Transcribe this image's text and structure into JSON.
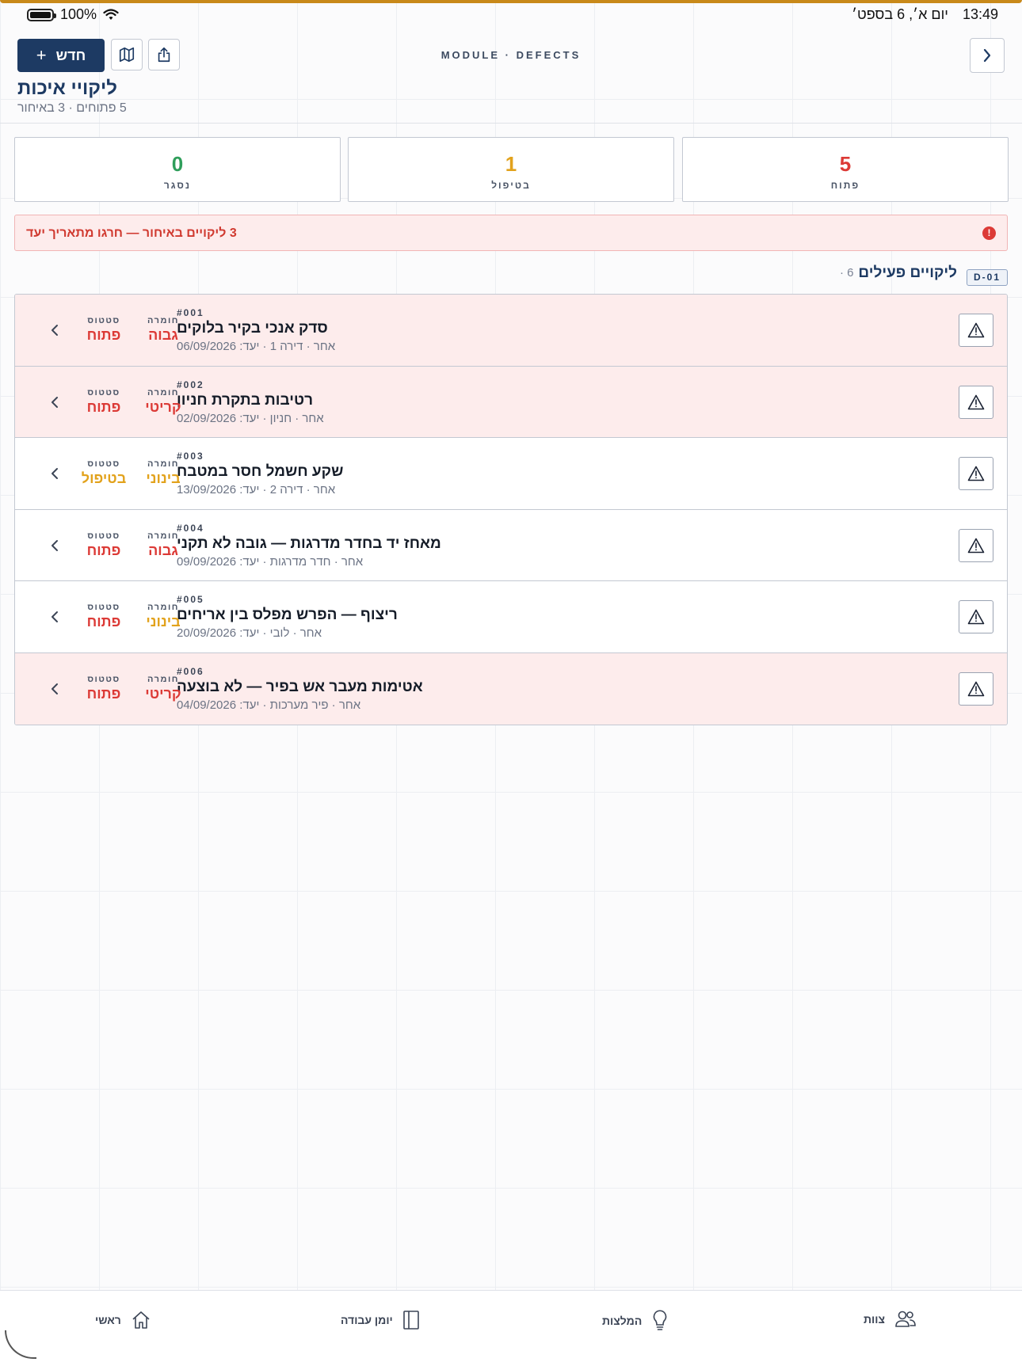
{
  "statusbar": {
    "battery": "100%",
    "time": "13:49",
    "date": "יום א׳, 6 בספט׳"
  },
  "header": {
    "new_button": "חדש",
    "module_label": "MODULE · DEFECTS",
    "title": "ליקויי איכות",
    "subtitle": "5 פתוחים · 3 באיחור",
    "icons": {
      "map": "map-icon",
      "share": "share-icon",
      "back": "chevron-right-icon",
      "plus": "plus-icon"
    }
  },
  "stats": [
    {
      "value": "5",
      "label": "פתוח",
      "color": "#dc3a36"
    },
    {
      "value": "1",
      "label": "בטיפול",
      "color": "#e2a21c"
    },
    {
      "value": "0",
      "label": "נסגר",
      "color": "#2f9e5b"
    }
  ],
  "alert": {
    "text": "3 ליקויים באיחור — חרגו מתאריך יעד",
    "icon": "alert-circle-icon"
  },
  "section": {
    "code": "D-01",
    "title": "ליקויים פעילים",
    "count": "· 6"
  },
  "columns": {
    "severity": "חומרה",
    "status": "סטטוס"
  },
  "defects": [
    {
      "code": "#001",
      "title": "סדק אנכי בקיר בלוקים",
      "meta": "אחר · דירה 1 · יעד: 06/09/2026",
      "severity": "גבוה",
      "severity_color": "#dc3a36",
      "status": "פתוח",
      "status_color": "#dc3a36",
      "overdue": true
    },
    {
      "code": "#002",
      "title": "רטיבות בתקרת חניון",
      "meta": "אחר · חניון · יעד: 02/09/2026",
      "severity": "קריטי",
      "severity_color": "#dc3a36",
      "status": "פתוח",
      "status_color": "#dc3a36",
      "overdue": true
    },
    {
      "code": "#003",
      "title": "שקע חשמל חסר במטבח",
      "meta": "אחר · דירה 2 · יעד: 13/09/2026",
      "severity": "בינוני",
      "severity_color": "#e2a21c",
      "status": "בטיפול",
      "status_color": "#e2a21c",
      "overdue": false
    },
    {
      "code": "#004",
      "title": "מאחז יד בחדר מדרגות — גובה לא תקני",
      "meta": "אחר · חדר מדרגות · יעד: 09/09/2026",
      "severity": "גבוה",
      "severity_color": "#dc3a36",
      "status": "פתוח",
      "status_color": "#dc3a36",
      "overdue": false
    },
    {
      "code": "#005",
      "title": "ריצוף — הפרש מפלס בין אריחים",
      "meta": "אחר · לובי · יעד: 20/09/2026",
      "severity": "בינוני",
      "severity_color": "#e2a21c",
      "status": "פתוח",
      "status_color": "#dc3a36",
      "overdue": false
    },
    {
      "code": "#006",
      "title": "אטימות מעבר אש בפיר — לא בוצעה",
      "meta": "אחר · פיר מערכות · יעד: 04/09/2026",
      "severity": "קריטי",
      "severity_color": "#dc3a36",
      "status": "פתוח",
      "status_color": "#dc3a36",
      "overdue": true
    }
  ],
  "nav": [
    {
      "label": "ראשי",
      "icon": "home-icon"
    },
    {
      "label": "יומן עבודה",
      "icon": "book-icon"
    },
    {
      "label": "המלצות",
      "icon": "lightbulb-icon"
    },
    {
      "label": "צוות",
      "icon": "team-icon"
    }
  ]
}
